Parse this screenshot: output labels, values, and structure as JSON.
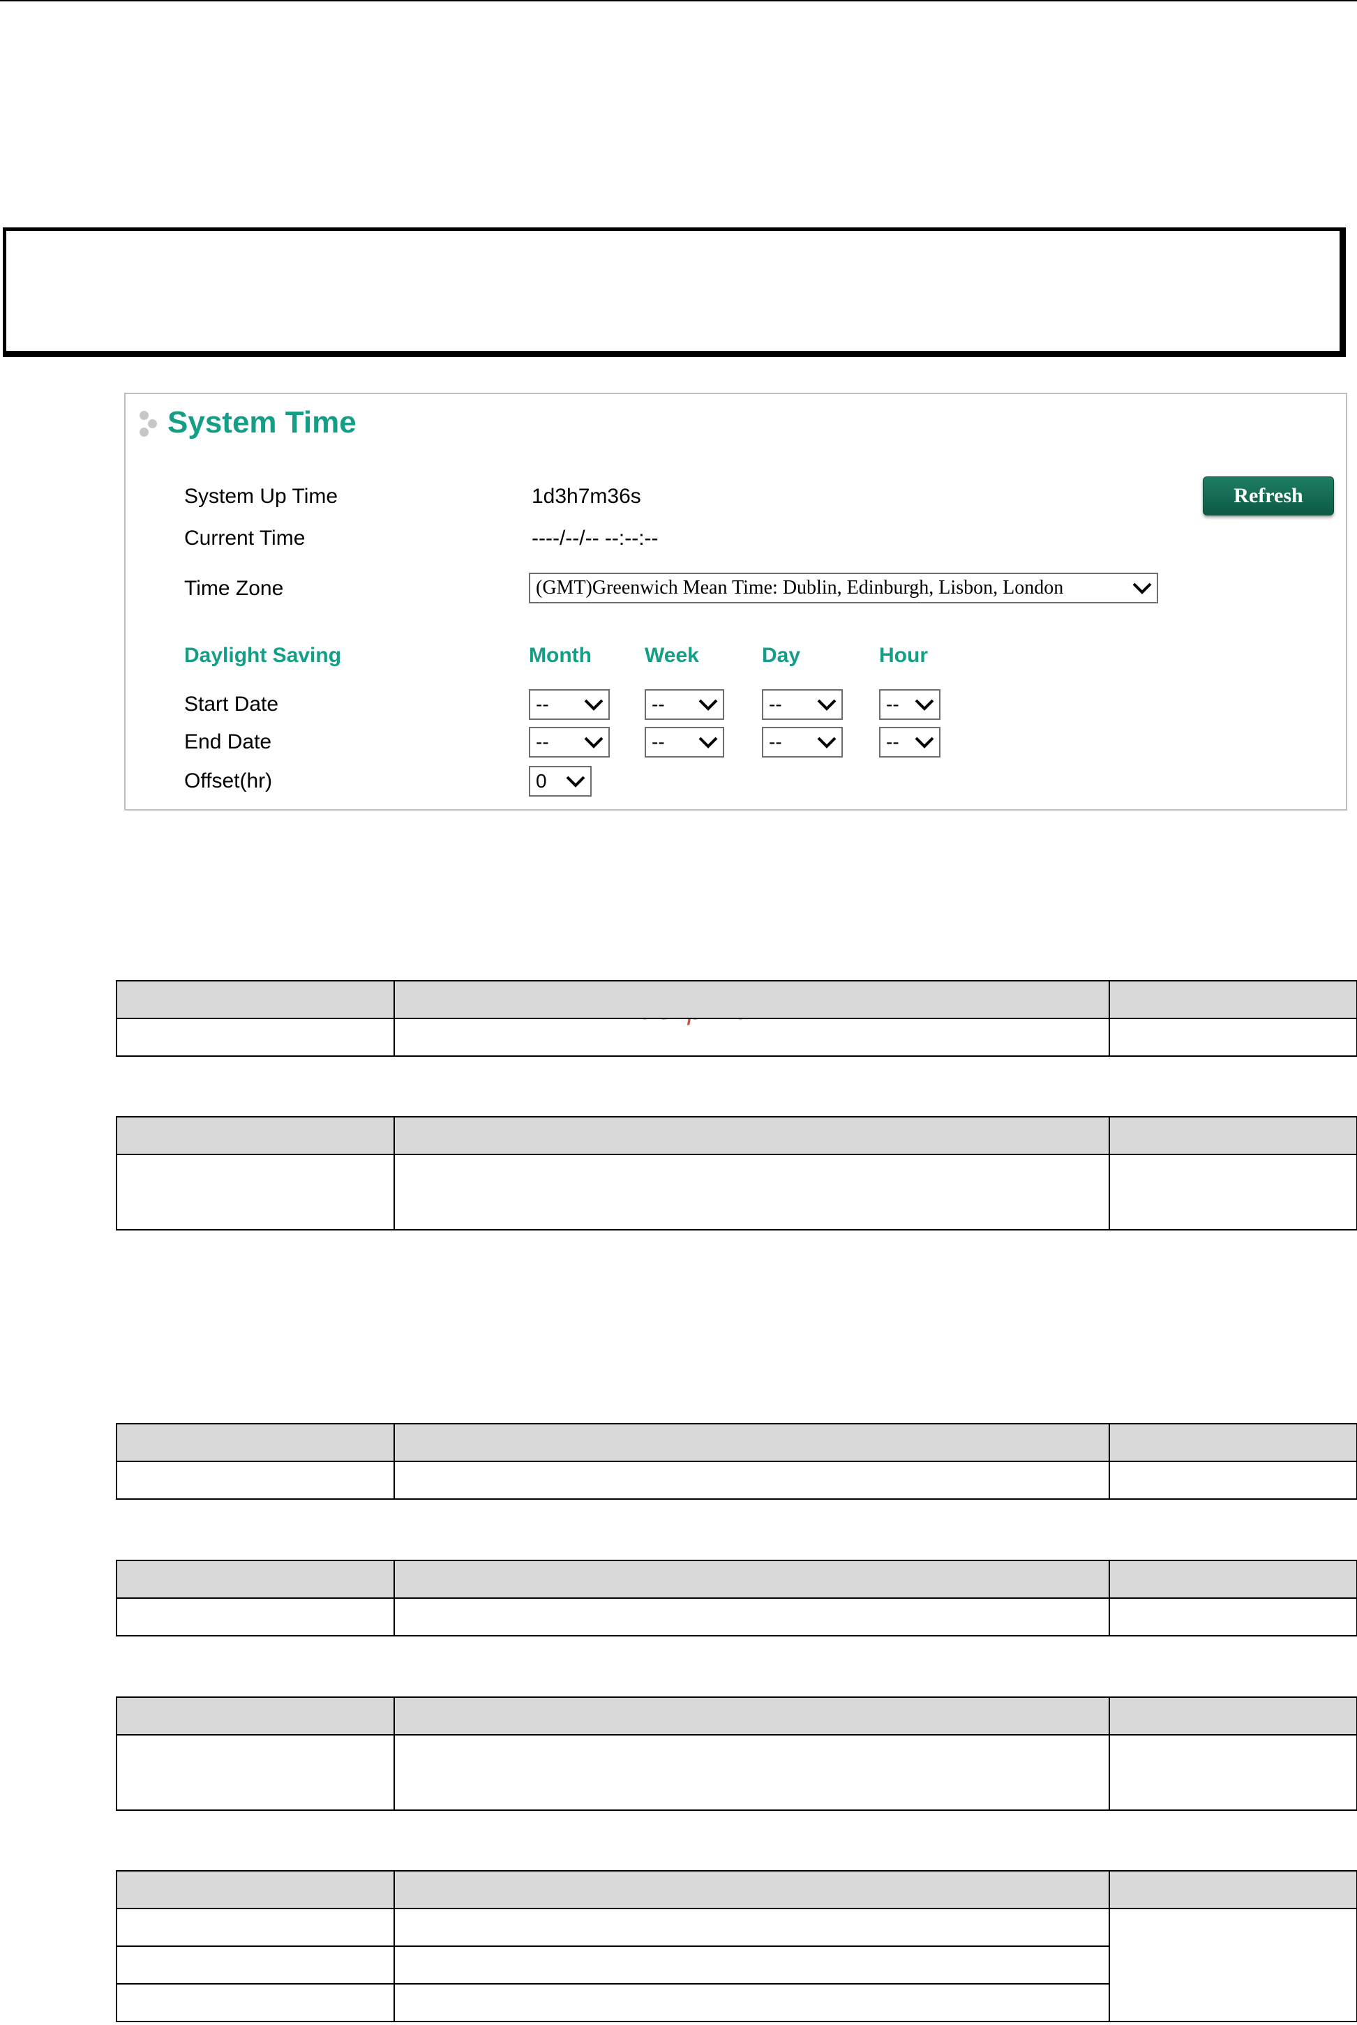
{
  "panel": {
    "title": "System Time",
    "refresh_label": "Refresh",
    "fields": {
      "system_up_time_label": "System Up Time",
      "system_up_time_value": "1d3h7m36s",
      "current_time_label": "Current Time",
      "current_time_value": "----/--/-- --:--:--",
      "time_zone_label": "Time Zone",
      "time_zone_value": "(GMT)Greenwich Mean Time: Dublin, Edinburgh, Lisbon, London"
    },
    "daylight": {
      "heading": "Daylight Saving",
      "columns": [
        "Month",
        "Week",
        "Day",
        "Hour"
      ],
      "start_label": "Start Date",
      "end_label": "End Date",
      "offset_label": "Offset(hr)",
      "start_values": [
        "--",
        "--",
        "--",
        "--"
      ],
      "end_values": [
        "--",
        "--",
        "--",
        "--"
      ],
      "offset_value": "0"
    }
  },
  "watermark": "McGrp.Ru"
}
